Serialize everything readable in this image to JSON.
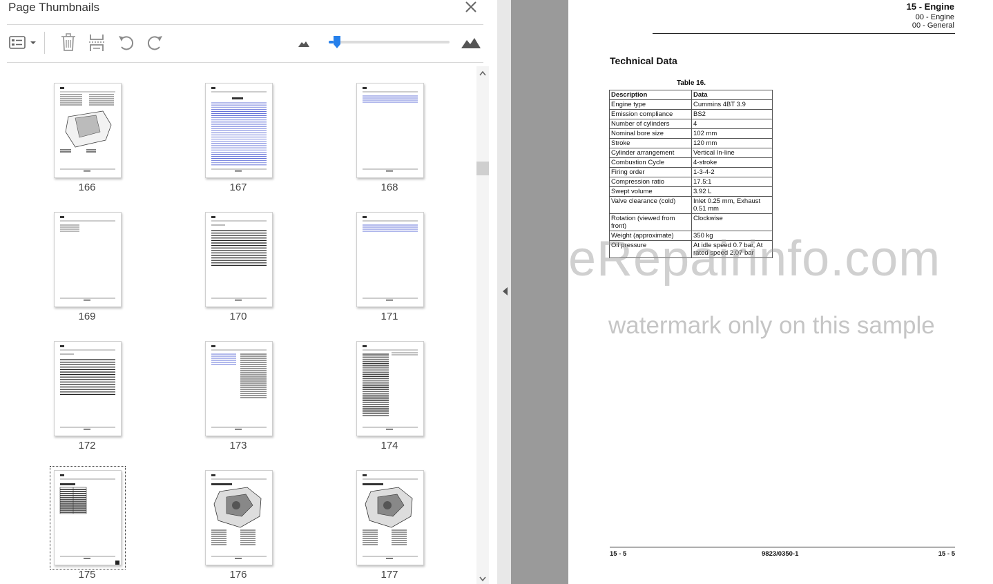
{
  "panel": {
    "title": "Page Thumbnails",
    "zoom_level": 0.04
  },
  "thumbnails": [
    {
      "page": "166",
      "type": "figure",
      "selected": false
    },
    {
      "page": "167",
      "type": "toc",
      "selected": false
    },
    {
      "page": "168",
      "type": "short-toc",
      "selected": false
    },
    {
      "page": "169",
      "type": "sparse",
      "selected": false
    },
    {
      "page": "170",
      "type": "lined",
      "selected": false
    },
    {
      "page": "171",
      "type": "short-toc",
      "selected": false
    },
    {
      "page": "172",
      "type": "lined",
      "selected": false
    },
    {
      "page": "173",
      "type": "two-col",
      "selected": false
    },
    {
      "page": "174",
      "type": "text",
      "selected": false
    },
    {
      "page": "175",
      "type": "table",
      "selected": true
    },
    {
      "page": "176",
      "type": "engine",
      "selected": false
    },
    {
      "page": "177",
      "type": "engine",
      "selected": false
    }
  ],
  "document": {
    "header_title": "15 - Engine",
    "header_sub1": "00 - Engine",
    "header_sub2": "00 - General",
    "section_title": "Technical Data",
    "table_caption": "Table 16.",
    "table_headers": [
      "Description",
      "Data"
    ],
    "table_rows": [
      [
        "Engine type",
        "Cummins 4BT 3.9"
      ],
      [
        "Emission compliance",
        "BS2"
      ],
      [
        "Number of cylinders",
        "4"
      ],
      [
        "Nominal bore size",
        "102 mm"
      ],
      [
        "Stroke",
        "120 mm"
      ],
      [
        "Cylinder arrangement",
        "Vertical In-line"
      ],
      [
        "Combustion Cycle",
        "4-stroke"
      ],
      [
        "Firing order",
        "1-3-4-2"
      ],
      [
        "Compression ratio",
        "17.5:1"
      ],
      [
        "Swept volume",
        "3.92 L"
      ],
      [
        "Valve clearance (cold)",
        "Inlet  0.25 mm, Exhaust 0.51 mm"
      ],
      [
        "Rotation (viewed from front)",
        "Clockwise"
      ],
      [
        "Weight (approximate)",
        "350 kg"
      ],
      [
        "Oil pressure",
        "At idle speed  0.7 bar, At rated speed  2.07 bar"
      ]
    ],
    "footer_left": "15 - 5",
    "footer_center": "9823/0350-1",
    "footer_right": "15 - 5",
    "watermark_main": "eRepairinfo.com",
    "watermark_sub": "watermark only on this sample"
  },
  "colors": {
    "accent": "#2680eb",
    "gutter": "#9a9a9a",
    "icon_gray": "#8a8a8a"
  }
}
